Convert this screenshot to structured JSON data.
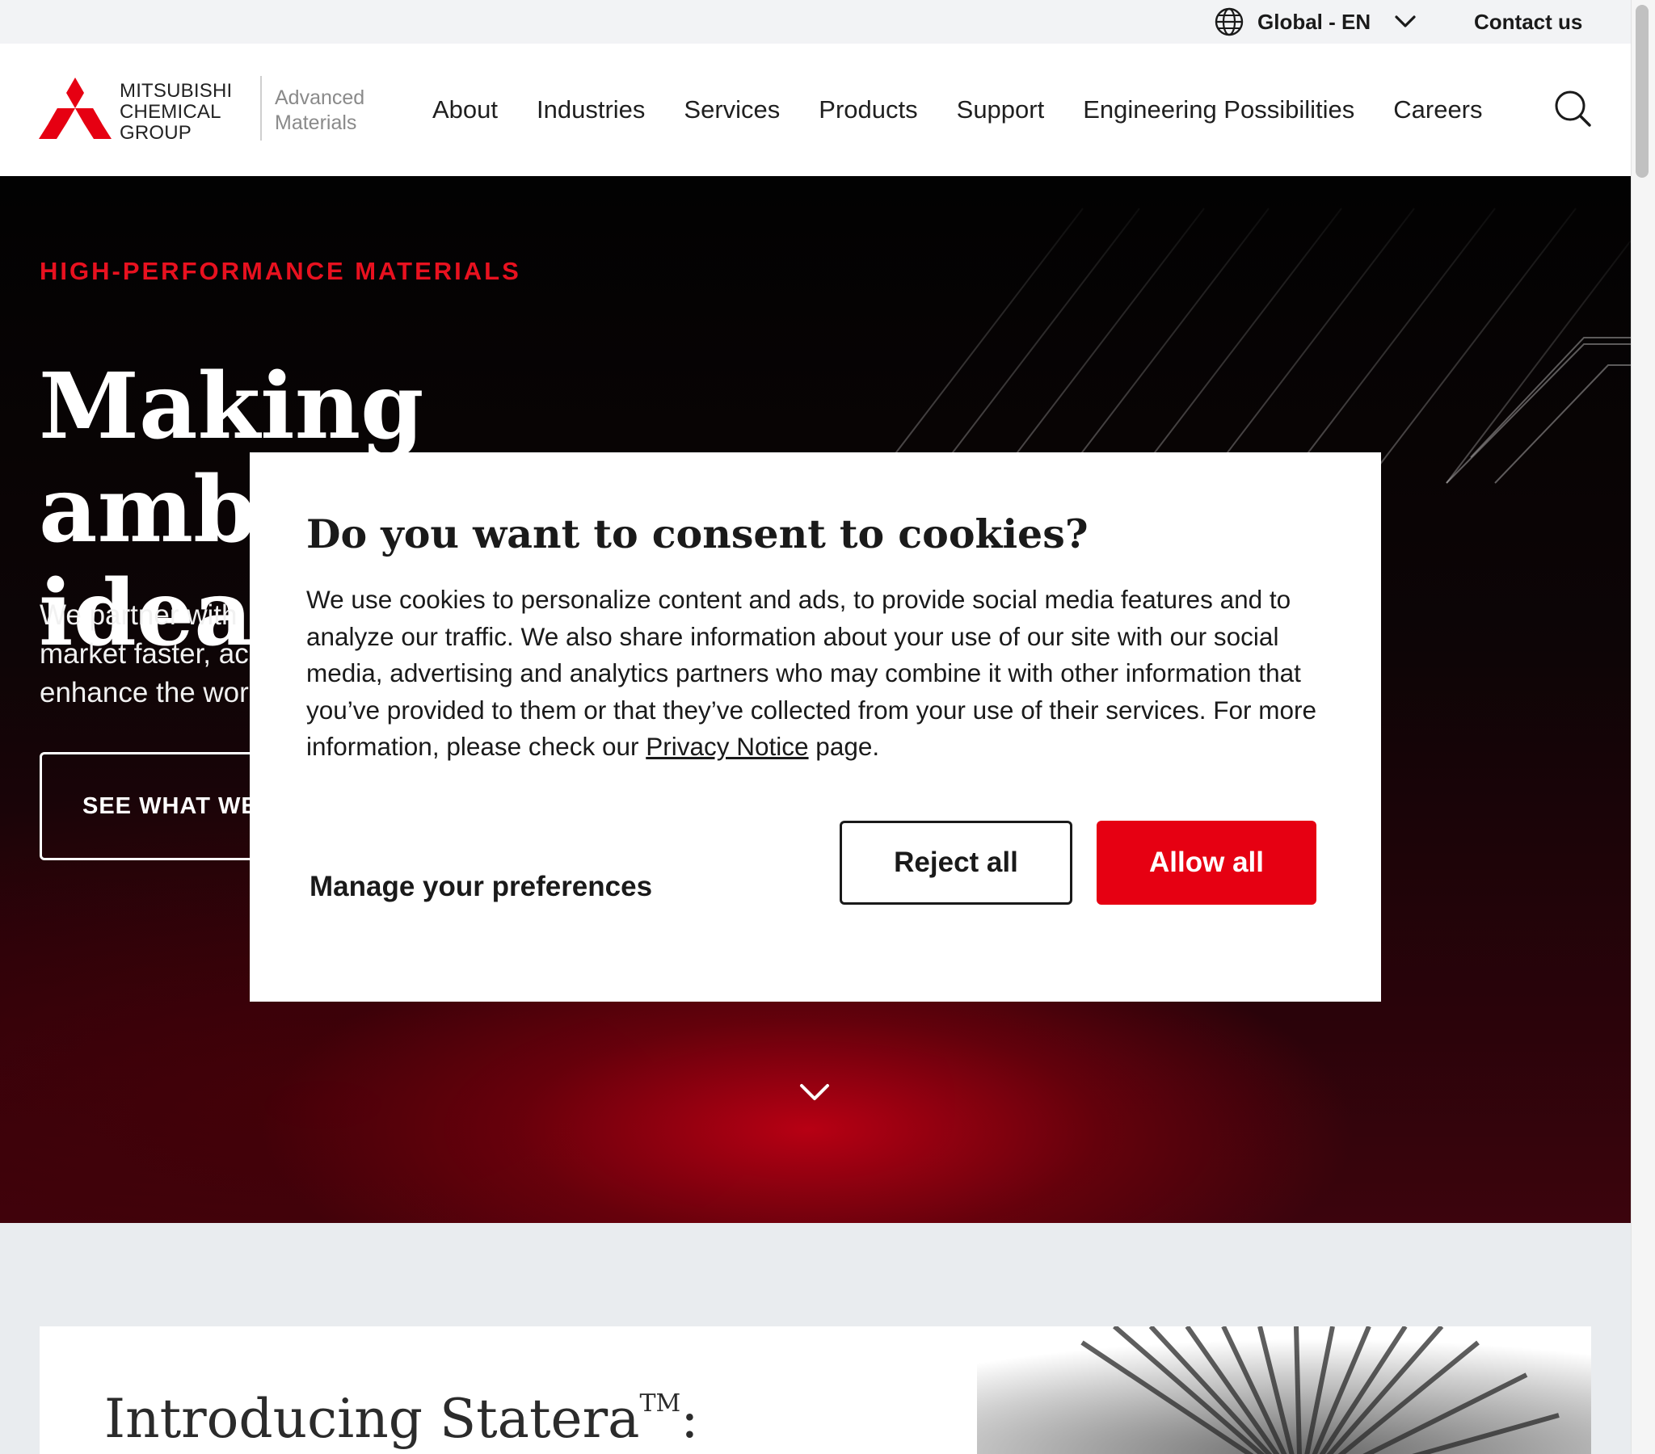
{
  "colors": {
    "brand_red": "#e60012",
    "eyebrow_red": "#e8111f",
    "hero_dark": "#020202"
  },
  "utility": {
    "locale_icon": "globe-icon",
    "locale_label": "Global - EN",
    "locale_chevron_icon": "chevron-down-icon",
    "contact_label": "Contact us"
  },
  "header": {
    "logo": {
      "line1": "MITSUBISHI",
      "line2": "CHEMICAL",
      "line3": "GROUP",
      "sub1": "Advanced",
      "sub2": "Materials"
    },
    "nav": [
      {
        "label": "About"
      },
      {
        "label": "Industries"
      },
      {
        "label": "Services"
      },
      {
        "label": "Products"
      },
      {
        "label": "Support"
      },
      {
        "label": "Engineering Possibilities"
      },
      {
        "label": "Careers"
      }
    ],
    "search_icon": "search-icon"
  },
  "hero": {
    "eyebrow": "HIGH-PERFORMANCE MATERIALS",
    "title_line1": "Making ambitious",
    "title_line2": "ideas",
    "body_line1": "We partner with",
    "body_line2": "market faster, ac",
    "body_line3": "enhance the wor",
    "cta_label": "SEE WHAT WE",
    "scroll_icon": "chevron-down-icon"
  },
  "promo": {
    "title": "Introducing Statera",
    "trademark": "TM",
    "title_suffix": ":"
  },
  "cookie_modal": {
    "title": "Do you want to consent to cookies?",
    "body_before_link": "We use cookies to personalize content and ads, to provide social media features and to analyze our traffic. We also share information about your use of our site with our social media, advertising and analytics partners who may combine it with other information that you’ve provided to them or that they’ve collected from your use of their services. For more information, please check our ",
    "link_label": "Privacy Notice",
    "body_after_link": " page.",
    "manage_label": "Manage your preferences",
    "reject_label": "Reject all",
    "allow_label": "Allow all"
  }
}
